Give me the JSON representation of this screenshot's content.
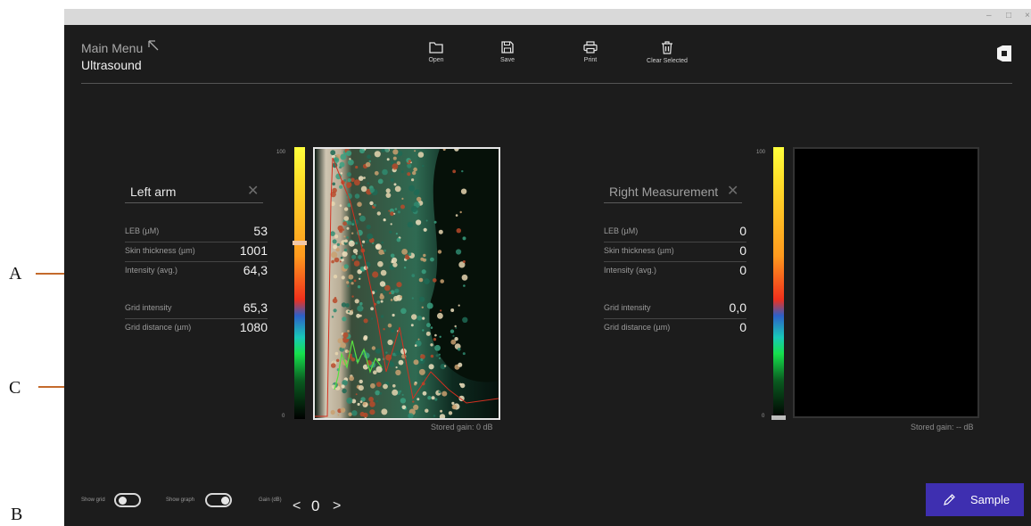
{
  "annotations": {
    "a": "A",
    "b": "B",
    "c": "C"
  },
  "window": {
    "minimize": "–",
    "maximize": "□",
    "close": "×"
  },
  "header": {
    "menu_title": "Main Menu",
    "page_title": "Ultrasound",
    "toolbar": [
      {
        "label": "Open",
        "icon": "folder-icon"
      },
      {
        "label": "Save",
        "icon": "save-icon"
      },
      {
        "label": "Print",
        "icon": "print-icon"
      },
      {
        "label": "Clear Selected",
        "icon": "trash-icon"
      }
    ]
  },
  "left_panel": {
    "title": "Left arm",
    "rows": [
      {
        "label": "LEB (µM)",
        "value": "53"
      },
      {
        "label": "Skin thickness (µm)",
        "value": "1001"
      },
      {
        "label": "Intensity (avg.)",
        "value": "64,3"
      },
      {
        "label": "Grid intensity",
        "value": "65,3"
      },
      {
        "label": "Grid distance (µm)",
        "value": "1080"
      }
    ],
    "scale_max": "100",
    "scale_min": "0",
    "stored_gain": "Stored gain: 0 dB"
  },
  "right_panel": {
    "title": "Right Measurement",
    "rows": [
      {
        "label": "LEB (µM)",
        "value": "0"
      },
      {
        "label": "Skin thickness (µm)",
        "value": "0"
      },
      {
        "label": "Intensity (avg.)",
        "value": "0"
      },
      {
        "label": "Grid intensity",
        "value": "0,0"
      },
      {
        "label": "Grid distance (µm)",
        "value": "0"
      }
    ],
    "scale_max": "100",
    "scale_min": "0",
    "stored_gain": "Stored gain: -- dB"
  },
  "footer": {
    "show_grid_label": "Show grid",
    "show_grid_on": false,
    "show_graph_label": "Show graph",
    "show_graph_on": true,
    "gain_label": "Gain (dB)",
    "gain_prev": "<",
    "gain_value": "0",
    "gain_next": ">",
    "sample_label": "Sample"
  },
  "colors": {
    "accent": "#3e2fb0",
    "background": "#1c1c1c",
    "arrow": "#c46a2c"
  }
}
